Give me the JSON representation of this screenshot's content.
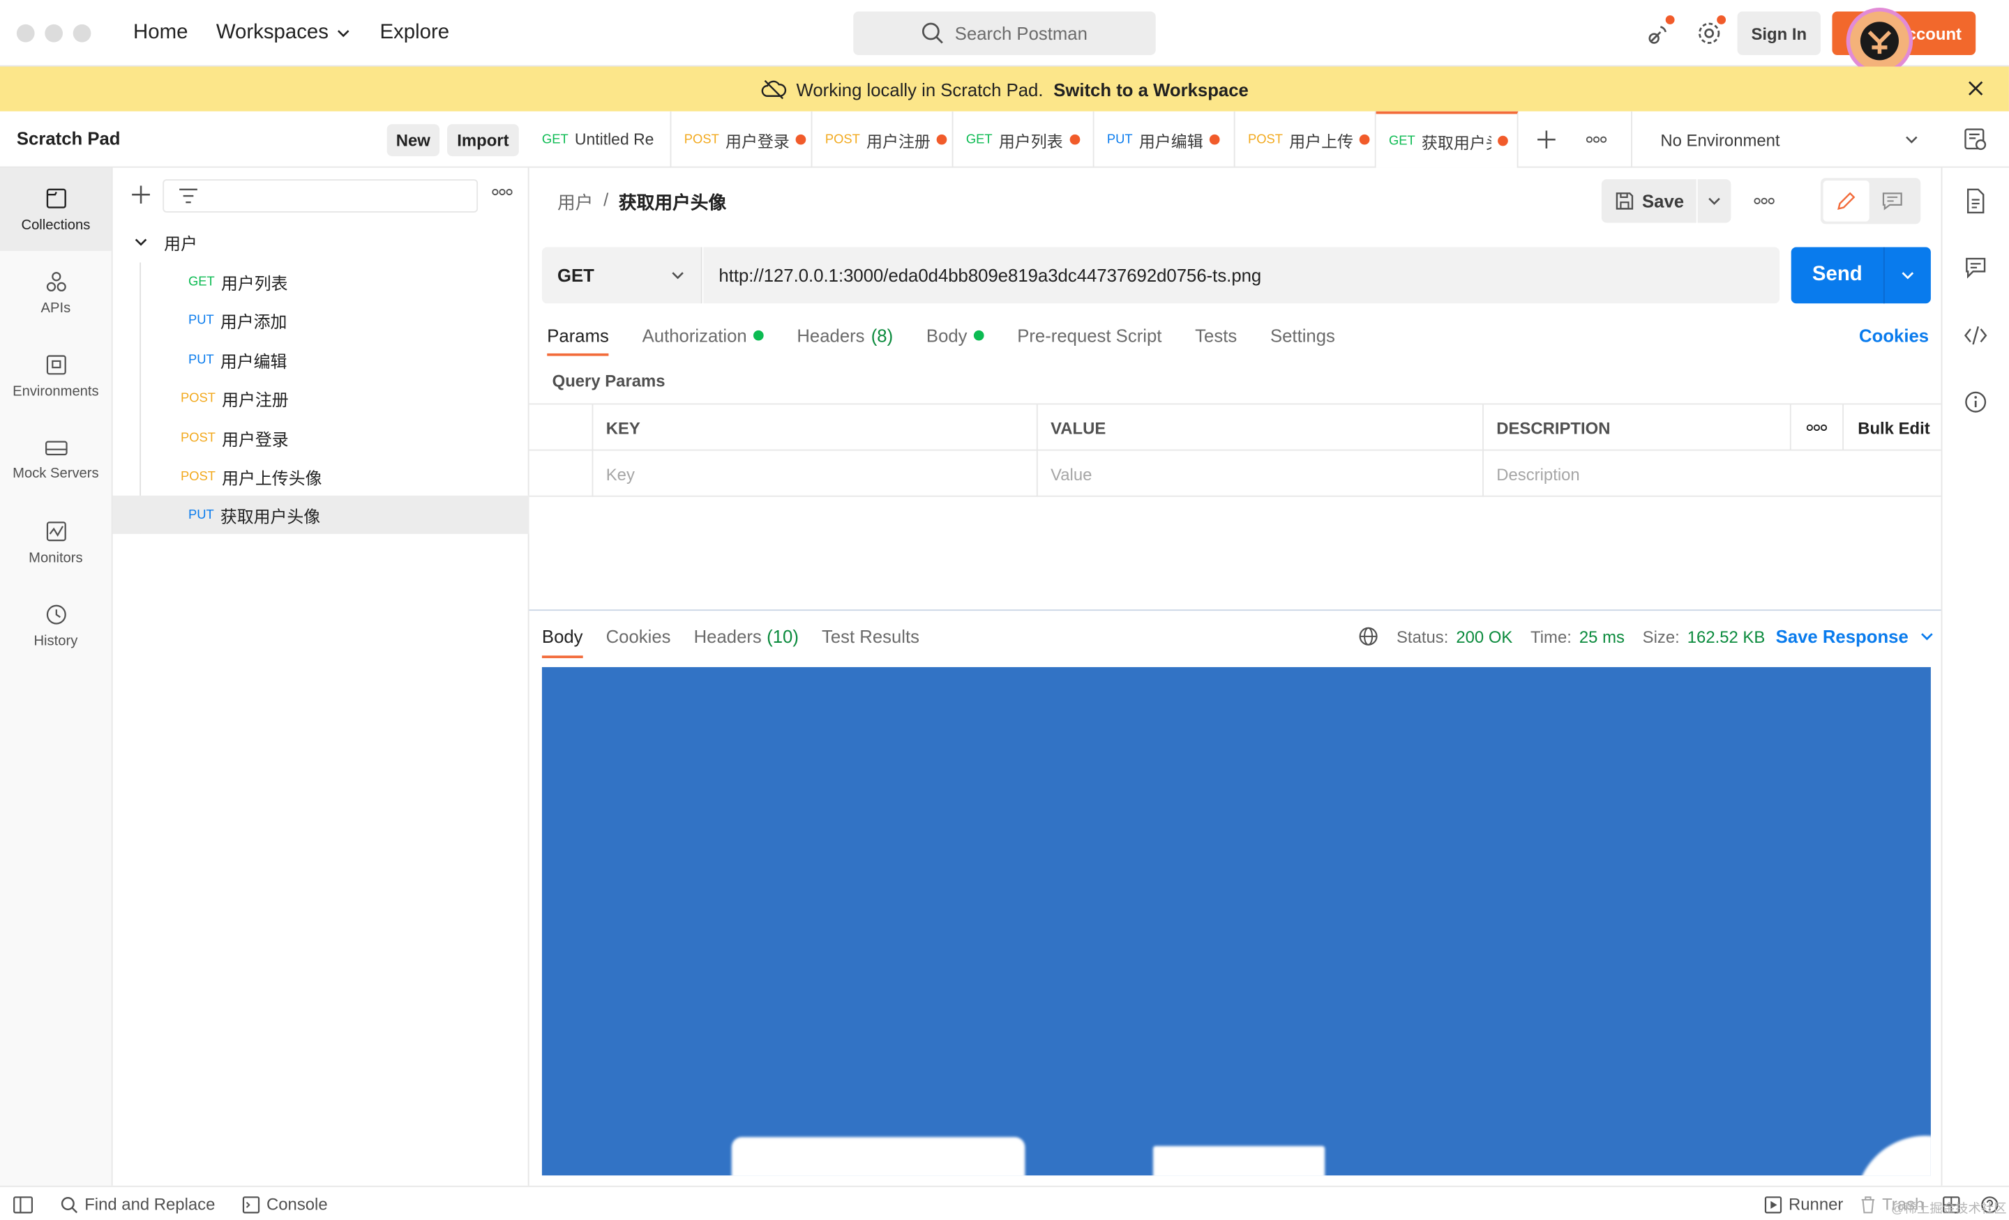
{
  "titlebar": {
    "nav": {
      "home": "Home",
      "workspaces": "Workspaces",
      "explore": "Explore"
    },
    "search_placeholder": "Search Postman",
    "sign_in": "Sign In",
    "create_account": "Account"
  },
  "banner": {
    "text": "Working locally in Scratch Pad.",
    "link": "Switch to a Workspace"
  },
  "sidebar": {
    "title": "Scratch Pad",
    "new_label": "New",
    "import_label": "Import",
    "rail": [
      {
        "label": "Collections",
        "icon": "collections-icon"
      },
      {
        "label": "APIs",
        "icon": "apis-icon"
      },
      {
        "label": "Environments",
        "icon": "environments-icon"
      },
      {
        "label": "Mock Servers",
        "icon": "mock-servers-icon"
      },
      {
        "label": "Monitors",
        "icon": "monitors-icon"
      },
      {
        "label": "History",
        "icon": "history-icon"
      }
    ],
    "collection": {
      "name": "用户",
      "requests": [
        {
          "method": "GET",
          "name": "用户列表"
        },
        {
          "method": "PUT",
          "name": "用户添加"
        },
        {
          "method": "PUT",
          "name": "用户编辑"
        },
        {
          "method": "POST",
          "name": "用户注册"
        },
        {
          "method": "POST",
          "name": "用户登录"
        },
        {
          "method": "POST",
          "name": "用户上传头像"
        },
        {
          "method": "PUT",
          "name": "获取用户头像"
        }
      ]
    }
  },
  "tabs": [
    {
      "method": "GET",
      "name": "Untitled Re"
    },
    {
      "method": "POST",
      "name": "用户登录"
    },
    {
      "method": "POST",
      "name": "用户注册"
    },
    {
      "method": "GET",
      "name": "用户列表"
    },
    {
      "method": "PUT",
      "name": "用户编辑"
    },
    {
      "method": "POST",
      "name": "用户上传"
    },
    {
      "method": "GET",
      "name": "获取用户头"
    }
  ],
  "environment": "No Environment",
  "request": {
    "breadcrumb_parent": "用户",
    "breadcrumb_sep": "/",
    "breadcrumb_current": "获取用户头像",
    "save_label": "Save",
    "method": "GET",
    "url": "http://127.0.0.1:3000/eda0d4bb809e819a3dc44737692d0756-ts.png",
    "send_label": "Send",
    "tabs": {
      "params": "Params",
      "authorization": "Authorization",
      "headers": "Headers",
      "headers_count": "(8)",
      "body": "Body",
      "prerequest": "Pre-request Script",
      "tests": "Tests",
      "settings": "Settings"
    },
    "cookies_link": "Cookies",
    "query_params_title": "Query Params",
    "table": {
      "headers": [
        "KEY",
        "VALUE",
        "DESCRIPTION"
      ],
      "bulk_edit": "Bulk Edit",
      "placeholders": [
        "Key",
        "Value",
        "Description"
      ]
    }
  },
  "response": {
    "tabs": {
      "body": "Body",
      "cookies": "Cookies",
      "headers": "Headers",
      "headers_count": "(10)",
      "test_results": "Test Results"
    },
    "status_label": "Status:",
    "status_value": "200 OK",
    "time_label": "Time:",
    "time_value": "25 ms",
    "size_label": "Size:",
    "size_value": "162.52 KB",
    "save_response": "Save Response",
    "preview_color": "#3273c5"
  },
  "statusbar": {
    "find_replace": "Find and Replace",
    "console": "Console",
    "runner": "Runner",
    "trash": "Trash",
    "watermark": "@稀土掘金技术社区"
  },
  "colors": {
    "accent": "#f26b3a",
    "primary_blue": "#097bed",
    "banner_bg": "#fce68a",
    "get": "#0cbb52",
    "put": "#097bed",
    "post": "#f2a91d"
  }
}
